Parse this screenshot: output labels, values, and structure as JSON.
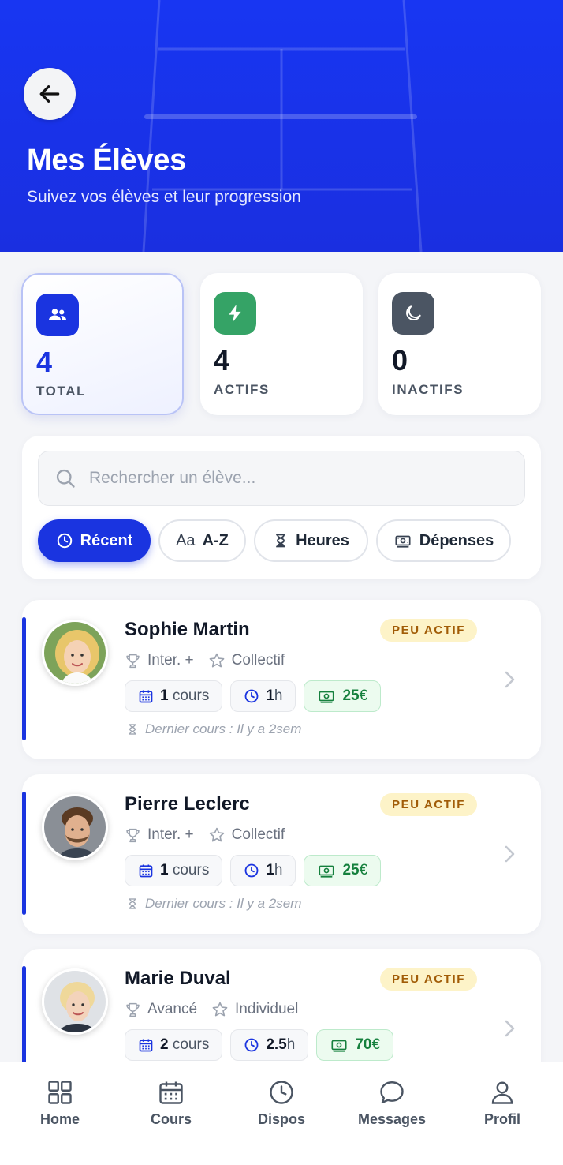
{
  "header": {
    "title": "Mes Élèves",
    "subtitle": "Suivez vos élèves et leur progression",
    "background_color": "#1a34e0"
  },
  "stats": [
    {
      "value": "4",
      "label": "TOTAL",
      "icon": "users-icon",
      "color": "#1a34e0",
      "selected": true
    },
    {
      "value": "4",
      "label": "ACTIFS",
      "icon": "lightning-icon",
      "color": "#35a366"
    },
    {
      "value": "0",
      "label": "INACTIFS",
      "icon": "moon-icon",
      "color": "#4b5563"
    }
  ],
  "search": {
    "placeholder": "Rechercher un élève...",
    "value": ""
  },
  "sort_chips": [
    {
      "label": "Récent",
      "icon": "clock-icon",
      "active": true
    },
    {
      "label": "A-Z",
      "prefix": "Aa",
      "icon": "text-icon"
    },
    {
      "label": "Heures",
      "icon": "hourglass-icon"
    },
    {
      "label": "Dépenses",
      "icon": "banknote-icon"
    }
  ],
  "students": [
    {
      "name": "Sophie Martin",
      "badge": "PEU ACTIF",
      "level": "Inter. +",
      "format": "Collectif",
      "courses_num": "1",
      "courses_unit": "cours",
      "hours_num": "1",
      "hours_unit": "h",
      "spent_num": "25",
      "spent_unit": "€",
      "last_lesson": "Dernier cours : Il y a 2sem"
    },
    {
      "name": "Pierre Leclerc",
      "badge": "PEU ACTIF",
      "level": "Inter. +",
      "format": "Collectif",
      "courses_num": "1",
      "courses_unit": "cours",
      "hours_num": "1",
      "hours_unit": "h",
      "spent_num": "25",
      "spent_unit": "€",
      "last_lesson": "Dernier cours : Il y a 2sem"
    },
    {
      "name": "Marie Duval",
      "badge": "PEU ACTIF",
      "level": "Avancé",
      "format": "Individuel",
      "courses_num": "2",
      "courses_unit": "cours",
      "hours_num": "2.5",
      "hours_unit": "h",
      "spent_num": "70",
      "spent_unit": "€",
      "last_lesson": ""
    }
  ],
  "nav": [
    {
      "label": "Home",
      "icon": "grid-icon"
    },
    {
      "label": "Cours",
      "icon": "calendar-icon"
    },
    {
      "label": "Dispos",
      "icon": "clock-icon"
    },
    {
      "label": "Messages",
      "icon": "chat-icon"
    },
    {
      "label": "Profil",
      "icon": "user-icon"
    }
  ],
  "colors": {
    "accent": "#1a34e0",
    "badge_bg": "#fdf3c8",
    "badge_text": "#a15c07",
    "money": "#15803d"
  }
}
